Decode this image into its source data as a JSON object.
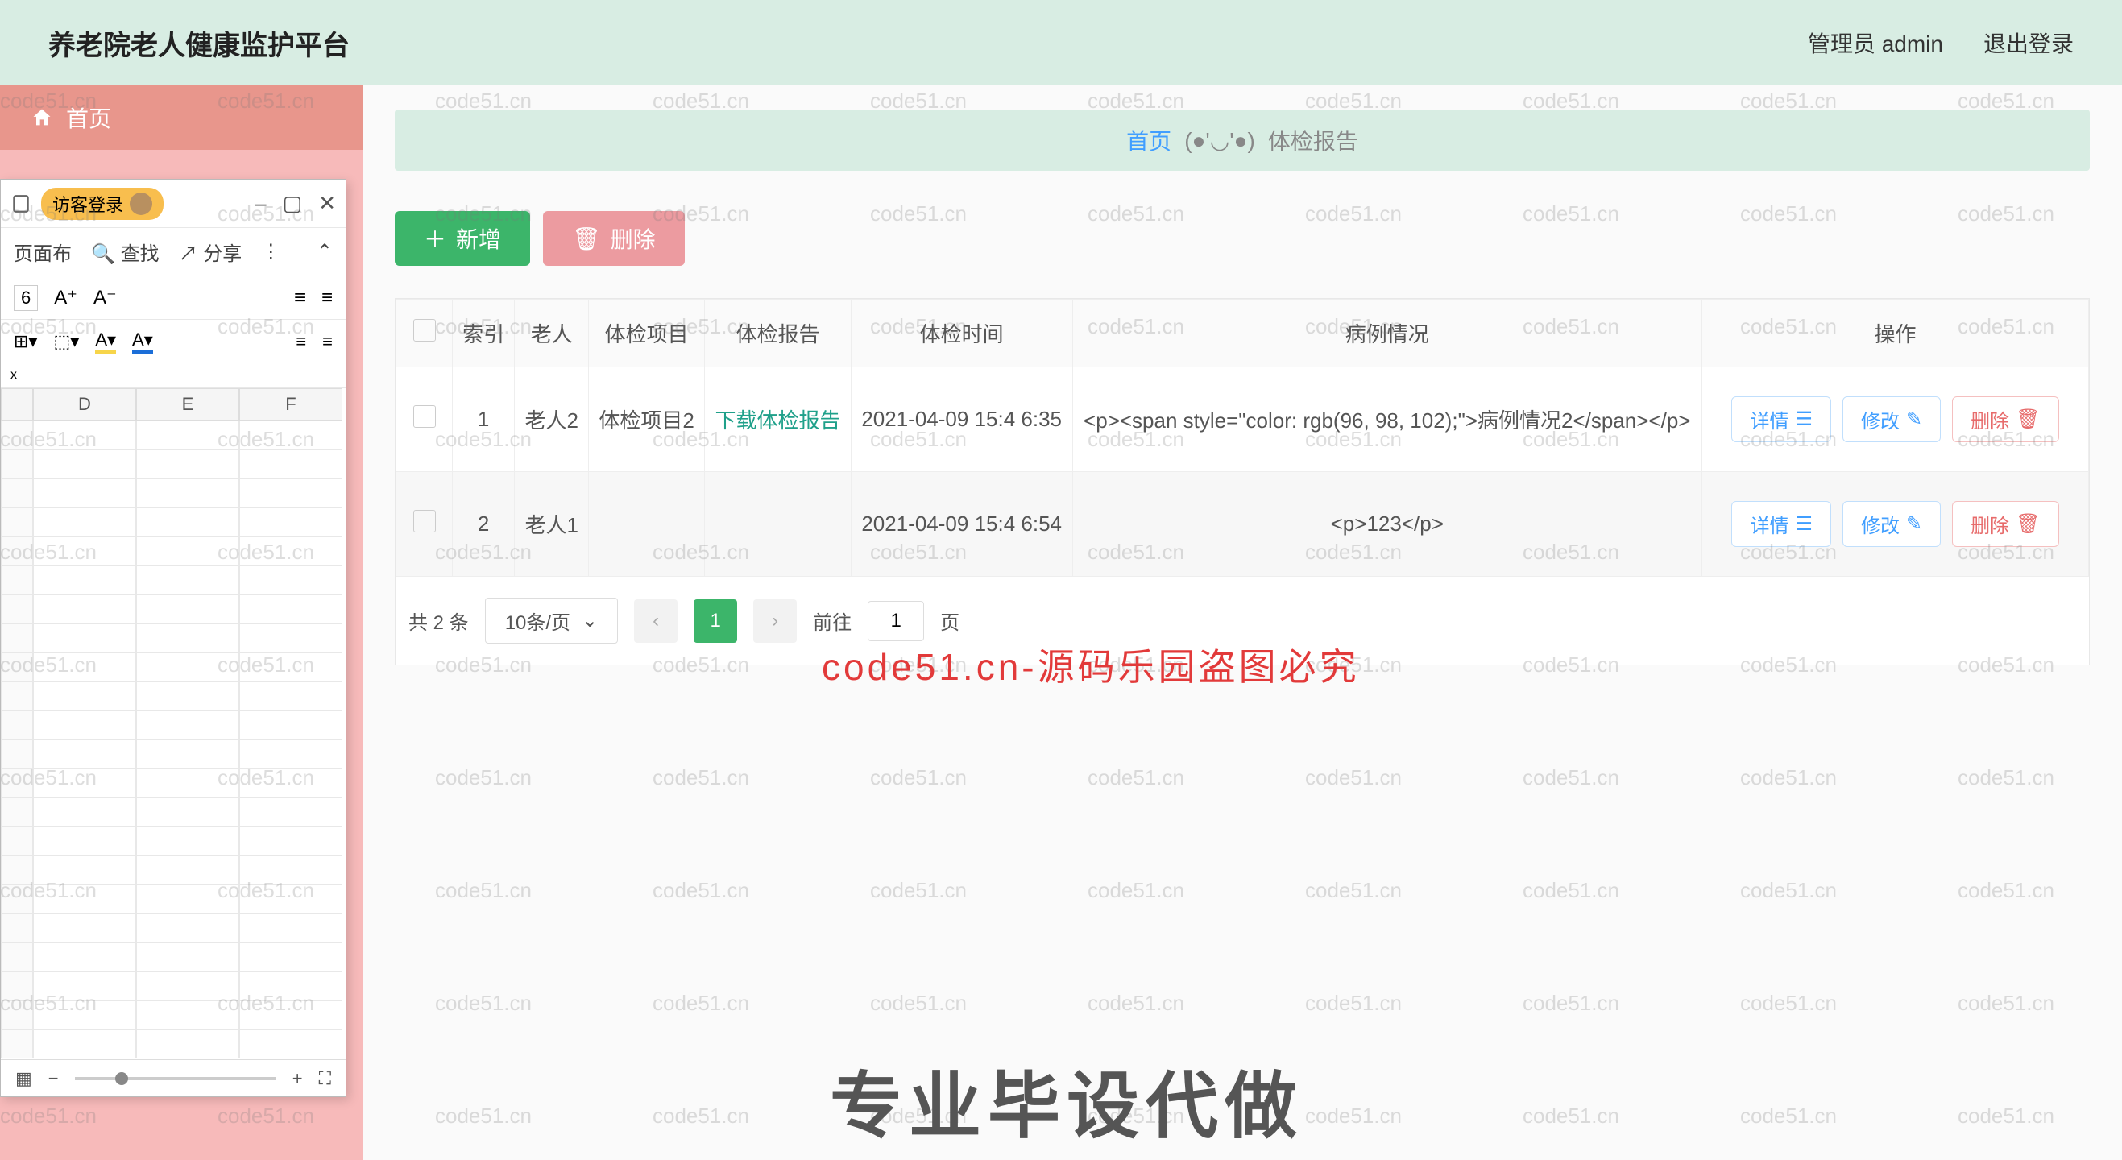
{
  "header": {
    "title": "养老院老人健康监护平台",
    "role": "管理员 admin",
    "logout": "退出登录"
  },
  "sidebar": {
    "home": "首页"
  },
  "excel": {
    "guest": "访客登录",
    "pagebtn": "页面布",
    "find": "查找",
    "share": "分享",
    "fontsize": "6",
    "cols": [
      "D",
      "E",
      "F"
    ],
    "formula_prefix": "x"
  },
  "breadcrumb": {
    "home": "首页",
    "face": "(●'◡'●)",
    "current": "体检报告"
  },
  "actions": {
    "add": "新增",
    "del": "删除"
  },
  "table": {
    "headers": [
      "索引",
      "老人",
      "体检项目",
      "体检报告",
      "体检时间",
      "病例情况",
      "操作"
    ],
    "rows": [
      {
        "idx": "1",
        "elder": "老人2",
        "item": "体检项目2",
        "report": "下载体检报告",
        "time": "2021-04-09 15:4 6:35",
        "case": "<p><span style=\"color: rgb(96, 98, 102);\">病例情况2</span></p>"
      },
      {
        "idx": "2",
        "elder": "老人1",
        "item": "",
        "report": "",
        "time": "2021-04-09 15:4 6:54",
        "case": "<p>123</p>"
      }
    ],
    "btn_detail": "详情",
    "btn_edit": "修改",
    "btn_del": "删除"
  },
  "pager": {
    "total": "共 2 条",
    "size": "10条/页",
    "page": "1",
    "goto": "前往",
    "goto_val": "1",
    "page_unit": "页"
  },
  "watermark": "code51.cn",
  "overlay_red": "code51.cn-源码乐园盗图必究",
  "overlay_big": "专业毕设代做"
}
